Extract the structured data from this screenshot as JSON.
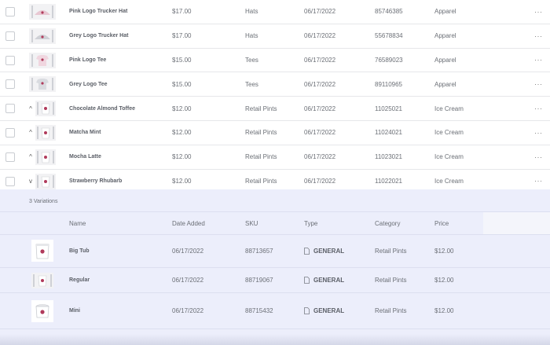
{
  "products": [
    {
      "name": "Pink Logo Trucker Hat",
      "price": "$17.00",
      "type": "Hats",
      "date": "06/17/2022",
      "sku": "85746385",
      "category": "Apparel",
      "expander": ""
    },
    {
      "name": "Grey Logo Trucker Hat",
      "price": "$17.00",
      "type": "Hats",
      "date": "06/17/2022",
      "sku": "55678834",
      "category": "Apparel",
      "expander": ""
    },
    {
      "name": "Pink Logo Tee",
      "price": "$15.00",
      "type": "Tees",
      "date": "06/17/2022",
      "sku": "76589023",
      "category": "Apparel",
      "expander": ""
    },
    {
      "name": "Grey Logo Tee",
      "price": "$15.00",
      "type": "Tees",
      "date": "06/17/2022",
      "sku": "89110965",
      "category": "Apparel",
      "expander": ""
    },
    {
      "name": "Chocolate Almond Toffee",
      "price": "$12.00",
      "type": "Retail Pints",
      "date": "06/17/2022",
      "sku": "11025021",
      "category": "Ice Cream",
      "expander": "^"
    },
    {
      "name": "Matcha Mint",
      "price": "$12.00",
      "type": "Retail Pints",
      "date": "06/17/2022",
      "sku": "11024021",
      "category": "Ice Cream",
      "expander": "^"
    },
    {
      "name": "Mocha Latte",
      "price": "$12.00",
      "type": "Retail Pints",
      "date": "06/17/2022",
      "sku": "11023021",
      "category": "Ice Cream",
      "expander": "^"
    },
    {
      "name": "Strawberry Rhubarb",
      "price": "$12.00",
      "type": "Retail Pints",
      "date": "06/17/2022",
      "sku": "11022021",
      "category": "Ice Cream",
      "expander": "v"
    }
  ],
  "more_label": "···",
  "variations": {
    "count_label": "3 Variations",
    "headers": {
      "name": "Name",
      "date": "Date Added",
      "sku": "SKU",
      "type": "Type",
      "category": "Category",
      "price": "Price"
    },
    "items": [
      {
        "name": "Big Tub",
        "date": "06/17/2022",
        "sku": "88713657",
        "type": "GENERAL",
        "category": "Retail Pints",
        "price": "$12.00"
      },
      {
        "name": "Regular",
        "date": "06/17/2022",
        "sku": "88719067",
        "type": "GENERAL",
        "category": "Retail Pints",
        "price": "$12.00"
      },
      {
        "name": "Mini",
        "date": "06/17/2022",
        "sku": "88715432",
        "type": "GENERAL",
        "category": "Retail Pints",
        "price": "$12.00"
      }
    ]
  },
  "colors": {
    "panel": "#eceefb",
    "border": "#e6e7ea",
    "text": "#6b6f76",
    "accent": "#b03a5b"
  }
}
